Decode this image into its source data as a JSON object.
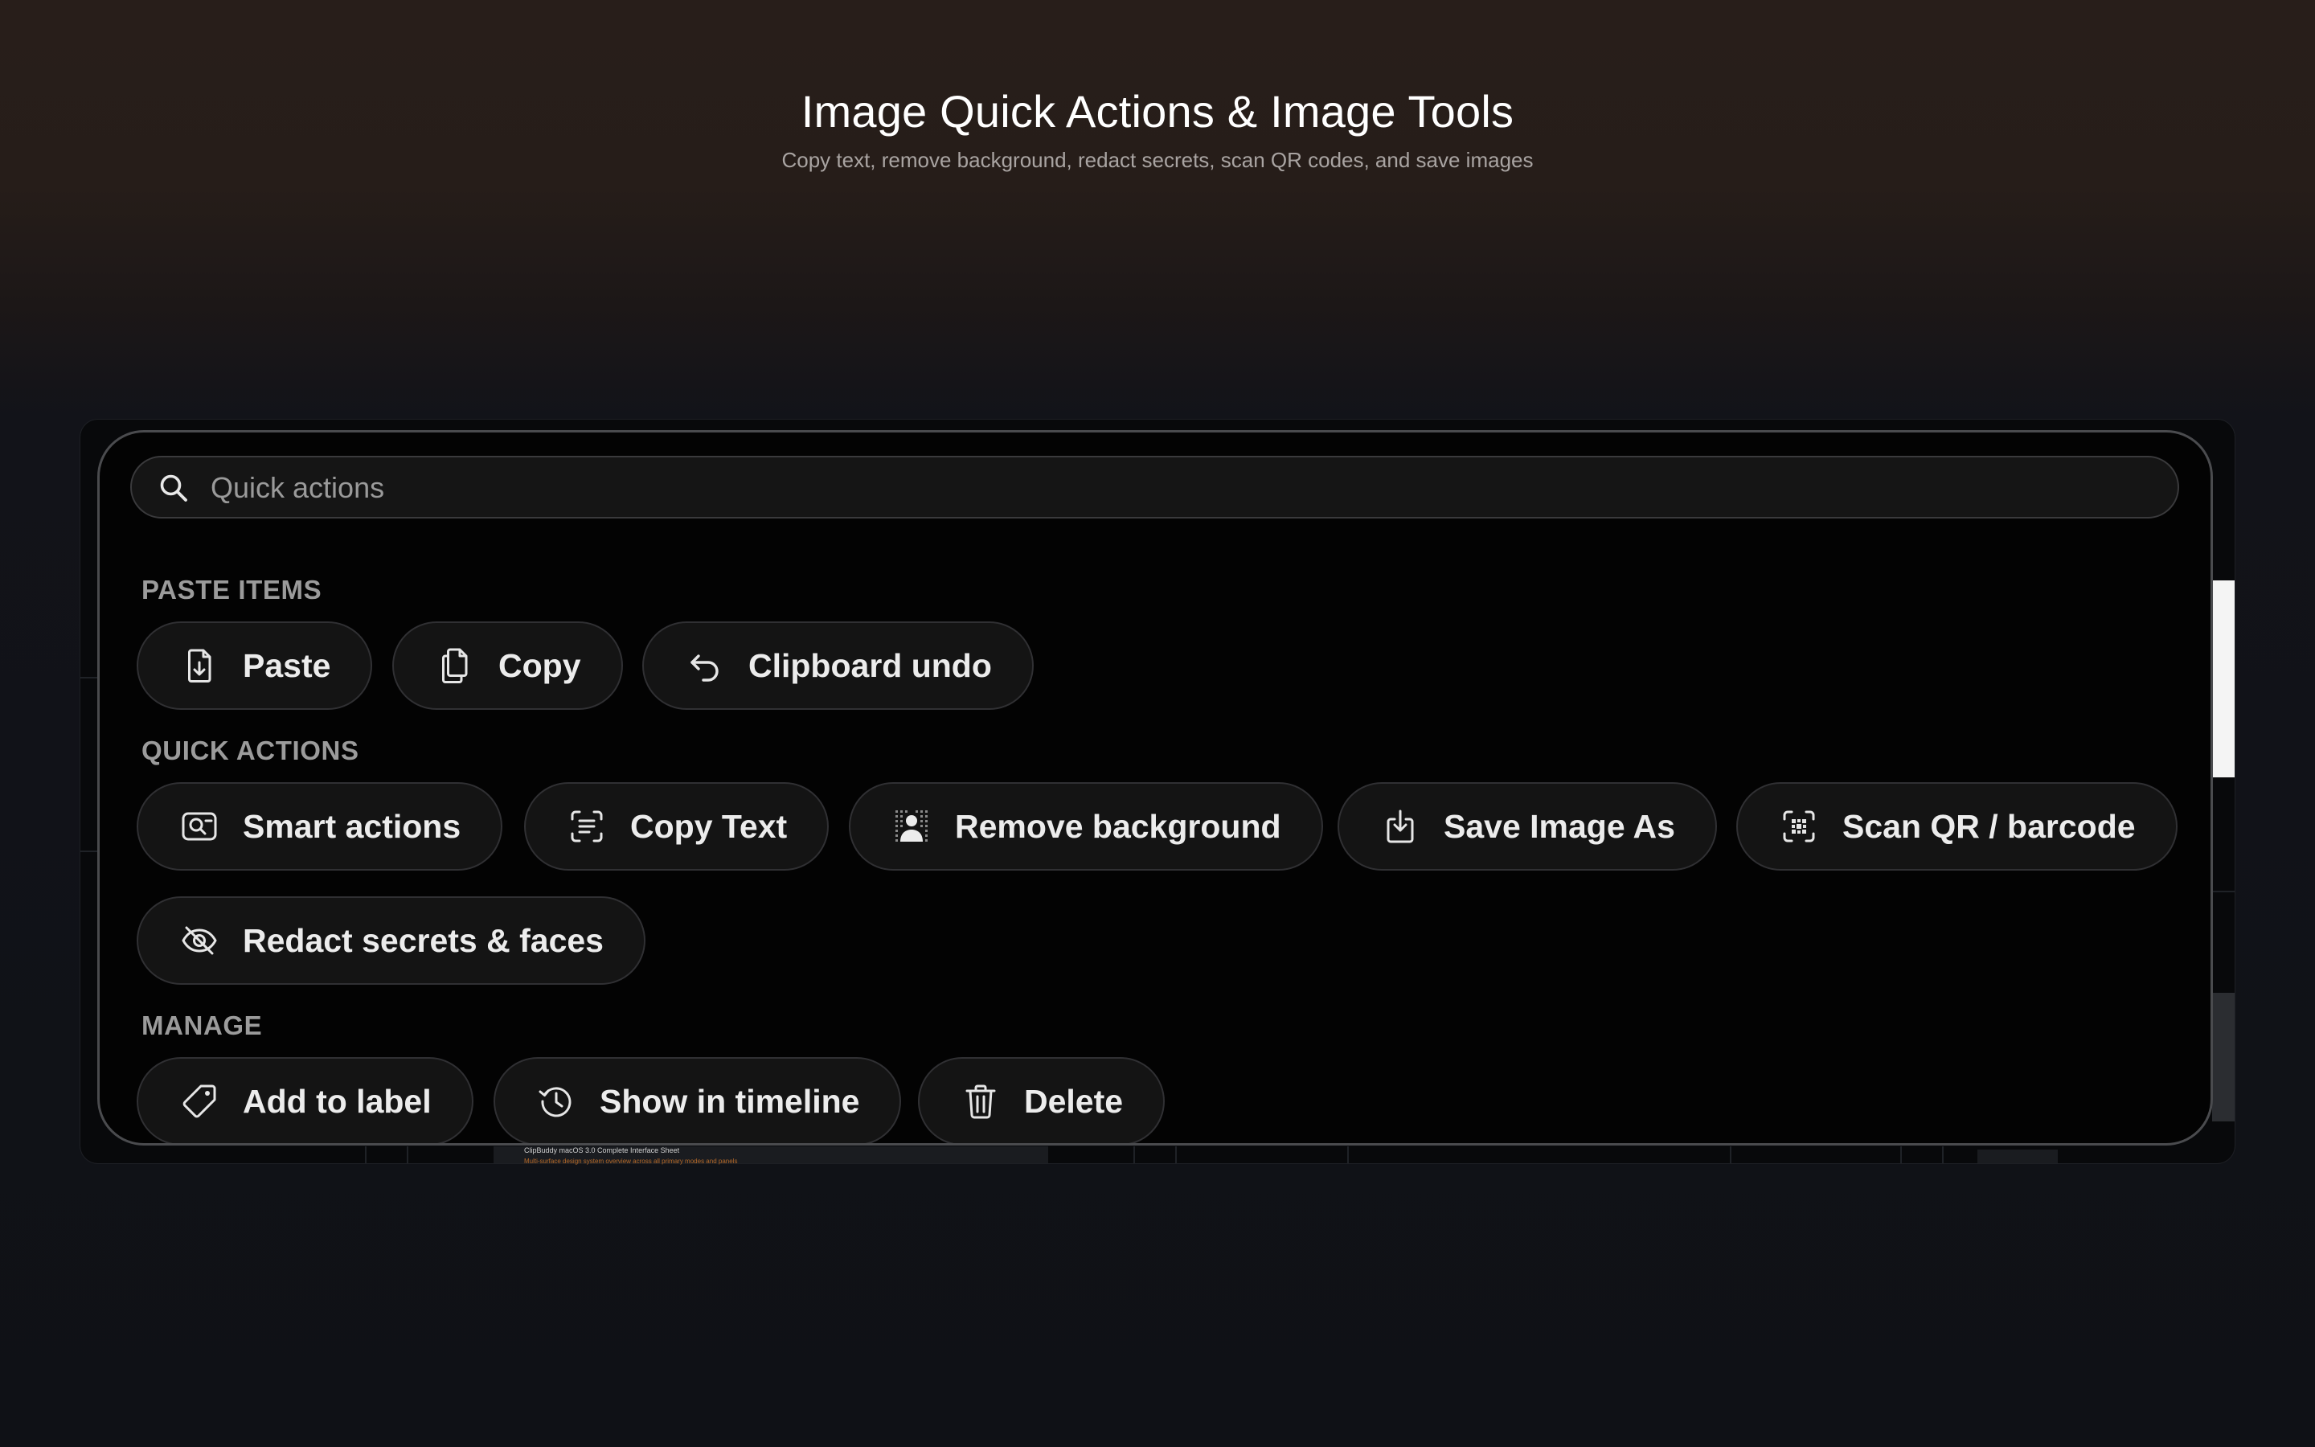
{
  "hero": {
    "title": "Image Quick Actions & Image Tools",
    "subtitle": "Copy text, remove background, redact secrets, scan QR codes, and save images"
  },
  "search": {
    "placeholder": "Quick actions",
    "value": ""
  },
  "sections": {
    "paste": {
      "label": "PASTE ITEMS",
      "items": [
        {
          "label": "Paste",
          "icon": "paste-icon"
        },
        {
          "label": "Copy",
          "icon": "copy-icon"
        },
        {
          "label": "Clipboard undo",
          "icon": "undo-icon"
        }
      ]
    },
    "quick": {
      "label": "QUICK ACTIONS",
      "items": [
        {
          "label": "Smart actions",
          "icon": "smart-actions-icon"
        },
        {
          "label": "Copy Text",
          "icon": "text-scan-icon"
        },
        {
          "label": "Remove background",
          "icon": "person-cutout-icon"
        },
        {
          "label": "Save Image As",
          "icon": "save-icon"
        },
        {
          "label": "Scan QR / barcode",
          "icon": "qr-scan-icon"
        },
        {
          "label": "Redact secrets & faces",
          "icon": "eye-slash-icon"
        }
      ]
    },
    "manage": {
      "label": "MANAGE",
      "items": [
        {
          "label": "Add to label",
          "icon": "tag-icon"
        },
        {
          "label": "Show in timeline",
          "icon": "history-icon"
        },
        {
          "label": "Delete",
          "icon": "trash-icon"
        }
      ]
    }
  },
  "background": {
    "doc_caption": "ClipBuddy macOS 3.0 Complete Interface Sheet",
    "doc_subcaption": "Multi-surface design system overview across all primary modes and panels"
  }
}
